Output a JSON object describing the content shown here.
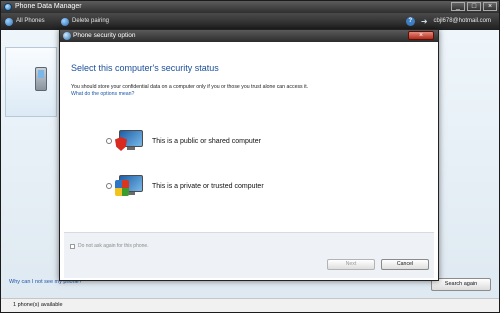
{
  "app": {
    "title": "Phone Data Manager",
    "toolbar": {
      "all_phones": "All Phones",
      "delete_pairing": "Delete pairing",
      "account": "cbjl678@hotmail.com"
    },
    "window_controls": {
      "minimize": "_",
      "maximize": "□",
      "close": "×"
    },
    "bottom_link": "Why can I not see my phone?",
    "search_button": "Search again",
    "status": "1 phone(s) available"
  },
  "dialog": {
    "title": "Phone security option",
    "heading": "Select this computer's security status",
    "description": "You should store your confidential data on a computer only if you or those you trust alone can access it.",
    "help_link": "What do the options mean?",
    "options": [
      {
        "label": "This is a public or shared computer",
        "icon": "monitor-warning-shield-icon",
        "selected": false
      },
      {
        "label": "This is a private or trusted computer",
        "icon": "monitor-trusted-shield-icon",
        "selected": false
      }
    ],
    "checkbox_label": "Do not ask again for this phone.",
    "checkbox_checked": false,
    "next_button": "Next",
    "cancel_button": "Cancel",
    "close_symbol": "×"
  }
}
